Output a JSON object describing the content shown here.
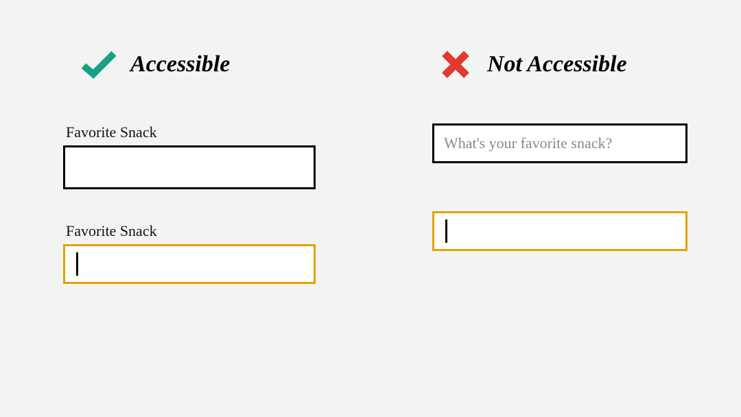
{
  "accessible": {
    "heading": "Accessible",
    "icon": "check-icon",
    "icon_color": "#16a085",
    "field_label_1": "Favorite Snack",
    "field_label_2": "Favorite Snack"
  },
  "not_accessible": {
    "heading": "Not Accessible",
    "icon": "x-icon",
    "icon_color": "#e03a2f",
    "placeholder": "What's your favorite snack?"
  }
}
